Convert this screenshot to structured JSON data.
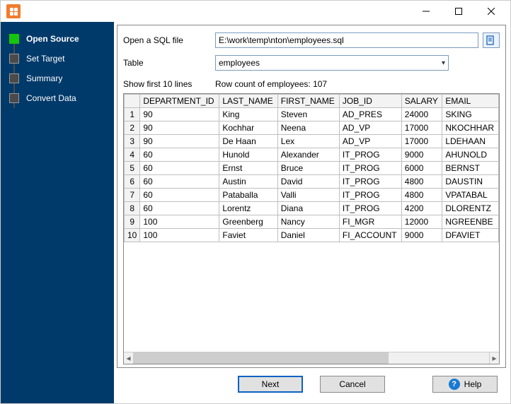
{
  "window": {
    "title": ""
  },
  "sidebar": {
    "steps": [
      {
        "label": "Open Source",
        "active": true
      },
      {
        "label": "Set Target",
        "active": false
      },
      {
        "label": "Summary",
        "active": false
      },
      {
        "label": "Convert Data",
        "active": false
      }
    ]
  },
  "form": {
    "openlabel": "Open a SQL file",
    "filepath": "E:\\work\\temp\\nton\\employees.sql",
    "tablelabel": "Table",
    "selected_table": "employees",
    "showfirst": "Show first 10 lines",
    "rowcount": "Row count of employees: 107"
  },
  "grid": {
    "columns": [
      "DEPARTMENT_ID",
      "LAST_NAME",
      "FIRST_NAME",
      "JOB_ID",
      "SALARY",
      "EMAIL"
    ],
    "rows": [
      [
        "90",
        "King",
        "Steven",
        "AD_PRES",
        "24000",
        "SKING"
      ],
      [
        "90",
        "Kochhar",
        "Neena",
        "AD_VP",
        "17000",
        "NKOCHHAR"
      ],
      [
        "90",
        "De Haan",
        "Lex",
        "AD_VP",
        "17000",
        "LDEHAAN"
      ],
      [
        "60",
        "Hunold",
        "Alexander",
        "IT_PROG",
        "9000",
        "AHUNOLD"
      ],
      [
        "60",
        "Ernst",
        "Bruce",
        "IT_PROG",
        "6000",
        "BERNST"
      ],
      [
        "60",
        "Austin",
        "David",
        "IT_PROG",
        "4800",
        "DAUSTIN"
      ],
      [
        "60",
        "Pataballa",
        "Valli",
        "IT_PROG",
        "4800",
        "VPATABAL"
      ],
      [
        "60",
        "Lorentz",
        "Diana",
        "IT_PROG",
        "4200",
        "DLORENTZ"
      ],
      [
        "100",
        "Greenberg",
        "Nancy",
        "FI_MGR",
        "12000",
        "NGREENBE"
      ],
      [
        "100",
        "Faviet",
        "Daniel",
        "FI_ACCOUNT",
        "9000",
        "DFAVIET"
      ]
    ]
  },
  "buttons": {
    "next": "Next",
    "cancel": "Cancel",
    "help": "Help"
  }
}
